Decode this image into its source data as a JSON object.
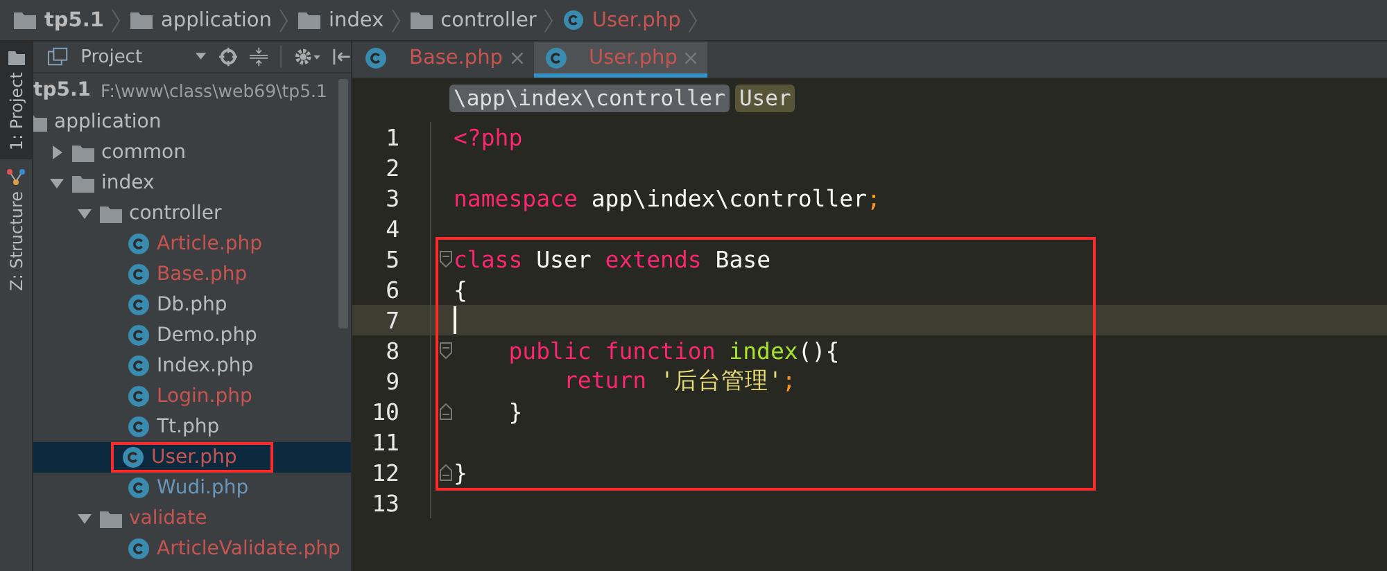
{
  "breadcrumb": [
    {
      "kind": "folder",
      "label": "tp5.1"
    },
    {
      "kind": "folder",
      "label": "application"
    },
    {
      "kind": "folder",
      "label": "index"
    },
    {
      "kind": "folder",
      "label": "controller"
    },
    {
      "kind": "class",
      "label": "User.php"
    }
  ],
  "side_tabs": [
    {
      "label": "1: Project",
      "selected": true
    },
    {
      "label": "Z: Structure",
      "selected": false
    }
  ],
  "project_panel": {
    "title": "Project",
    "root": {
      "label": "tp5.1",
      "path": "F:\\www\\class\\web69\\tp5.1"
    },
    "tree": [
      {
        "kind": "folder",
        "label": "application",
        "selected": false,
        "boxed": false,
        "color": "#bbbbbb",
        "children": [
          {
            "kind": "folder",
            "label": "common",
            "expanded": false,
            "selected": false,
            "boxed": false,
            "color": "#bbbbbb"
          },
          {
            "kind": "folder",
            "label": "index",
            "expanded": true,
            "selected": false,
            "boxed": false,
            "color": "#bbbbbb",
            "children": [
              {
                "kind": "folder",
                "label": "controller",
                "expanded": true,
                "selected": false,
                "boxed": false,
                "color": "#bbbbbb",
                "children": [
                  {
                    "kind": "class",
                    "label": "Article.php",
                    "selected": false,
                    "boxed": false,
                    "color": "#c75450"
                  },
                  {
                    "kind": "class",
                    "label": "Base.php",
                    "selected": false,
                    "boxed": false,
                    "color": "#c75450"
                  },
                  {
                    "kind": "class",
                    "label": "Db.php",
                    "selected": false,
                    "boxed": false,
                    "color": "#bbbbbb"
                  },
                  {
                    "kind": "class",
                    "label": "Demo.php",
                    "selected": false,
                    "boxed": false,
                    "color": "#bbbbbb"
                  },
                  {
                    "kind": "class",
                    "label": "Index.php",
                    "selected": false,
                    "boxed": false,
                    "color": "#bbbbbb"
                  },
                  {
                    "kind": "class",
                    "label": "Login.php",
                    "selected": false,
                    "boxed": false,
                    "color": "#c75450"
                  },
                  {
                    "kind": "class",
                    "label": "Tt.php",
                    "selected": false,
                    "boxed": false,
                    "color": "#bbbbbb"
                  },
                  {
                    "kind": "class",
                    "label": "User.php",
                    "selected": true,
                    "boxed": true,
                    "color": "#c75450"
                  },
                  {
                    "kind": "class",
                    "label": "Wudi.php",
                    "selected": false,
                    "boxed": false,
                    "color": "#6897bb"
                  }
                ]
              },
              {
                "kind": "folder",
                "label": "validate",
                "expanded": true,
                "selected": false,
                "boxed": false,
                "color": "#c75450",
                "children": [
                  {
                    "kind": "class",
                    "label": "ArticleValidate.php",
                    "selected": false,
                    "boxed": false,
                    "color": "#c75450"
                  }
                ]
              }
            ]
          }
        ]
      }
    ]
  },
  "editor_tabs": [
    {
      "label": "Base.php",
      "selected": false
    },
    {
      "label": "User.php",
      "selected": true
    }
  ],
  "code_breadcrumb": [
    {
      "kind": "namespace",
      "label": "\\app\\index\\controller"
    },
    {
      "kind": "class",
      "label": "User"
    }
  ],
  "code_lines": [
    {
      "number": "1",
      "current": false,
      "boxed": false,
      "fold_start": false,
      "fold_end": false,
      "tokens": [
        {
          "kind": "tag",
          "text": "<?php"
        }
      ]
    },
    {
      "number": "2",
      "current": false,
      "boxed": false,
      "fold_start": false,
      "fold_end": false
    },
    {
      "number": "3",
      "current": false,
      "boxed": false,
      "fold_start": false,
      "fold_end": false,
      "tokens": [
        {
          "kind": "keyword",
          "text": "namespace"
        },
        {
          "kind": "plain",
          "text": " app\\index\\controller"
        },
        {
          "kind": "punct",
          "text": ";"
        }
      ]
    },
    {
      "number": "4",
      "current": false,
      "boxed": false,
      "fold_start": false,
      "fold_end": false
    },
    {
      "number": "5",
      "current": false,
      "boxed": true,
      "fold_start": true,
      "fold_end": false,
      "tokens": [
        {
          "kind": "keyword",
          "text": "class"
        },
        {
          "kind": "plain",
          "text": " User "
        },
        {
          "kind": "keyword",
          "text": "extends"
        },
        {
          "kind": "plain",
          "text": " Base"
        }
      ]
    },
    {
      "number": "6",
      "current": false,
      "boxed": true,
      "fold_start": false,
      "fold_end": false,
      "tokens": [
        {
          "kind": "plain",
          "text": "{"
        }
      ]
    },
    {
      "number": "7",
      "current": true,
      "boxed": true,
      "fold_start": false,
      "fold_end": false
    },
    {
      "number": "8",
      "current": false,
      "boxed": true,
      "fold_start": true,
      "fold_end": false,
      "tokens": [
        {
          "kind": "keyword",
          "text": "    public"
        },
        {
          "kind": "keyword",
          "text": " function"
        },
        {
          "kind": "function",
          "text": " index"
        },
        {
          "kind": "plain",
          "text": "(){"
        }
      ]
    },
    {
      "number": "9",
      "current": false,
      "boxed": true,
      "fold_start": false,
      "fold_end": false,
      "tokens": [
        {
          "kind": "keyword",
          "text": "        return"
        },
        {
          "kind": "string",
          "text": " '后台管理'"
        },
        {
          "kind": "punct",
          "text": ";"
        }
      ]
    },
    {
      "number": "10",
      "current": false,
      "boxed": true,
      "fold_start": false,
      "fold_end": true,
      "tokens": [
        {
          "kind": "plain",
          "text": "    }"
        }
      ]
    },
    {
      "number": "11",
      "current": false,
      "boxed": true,
      "fold_start": false,
      "fold_end": false
    },
    {
      "number": "12",
      "current": false,
      "boxed": true,
      "fold_start": false,
      "fold_end": true,
      "tokens": [
        {
          "kind": "plain",
          "text": "}"
        }
      ]
    },
    {
      "number": "13",
      "current": false,
      "boxed": false,
      "fold_start": false,
      "fold_end": false
    }
  ]
}
